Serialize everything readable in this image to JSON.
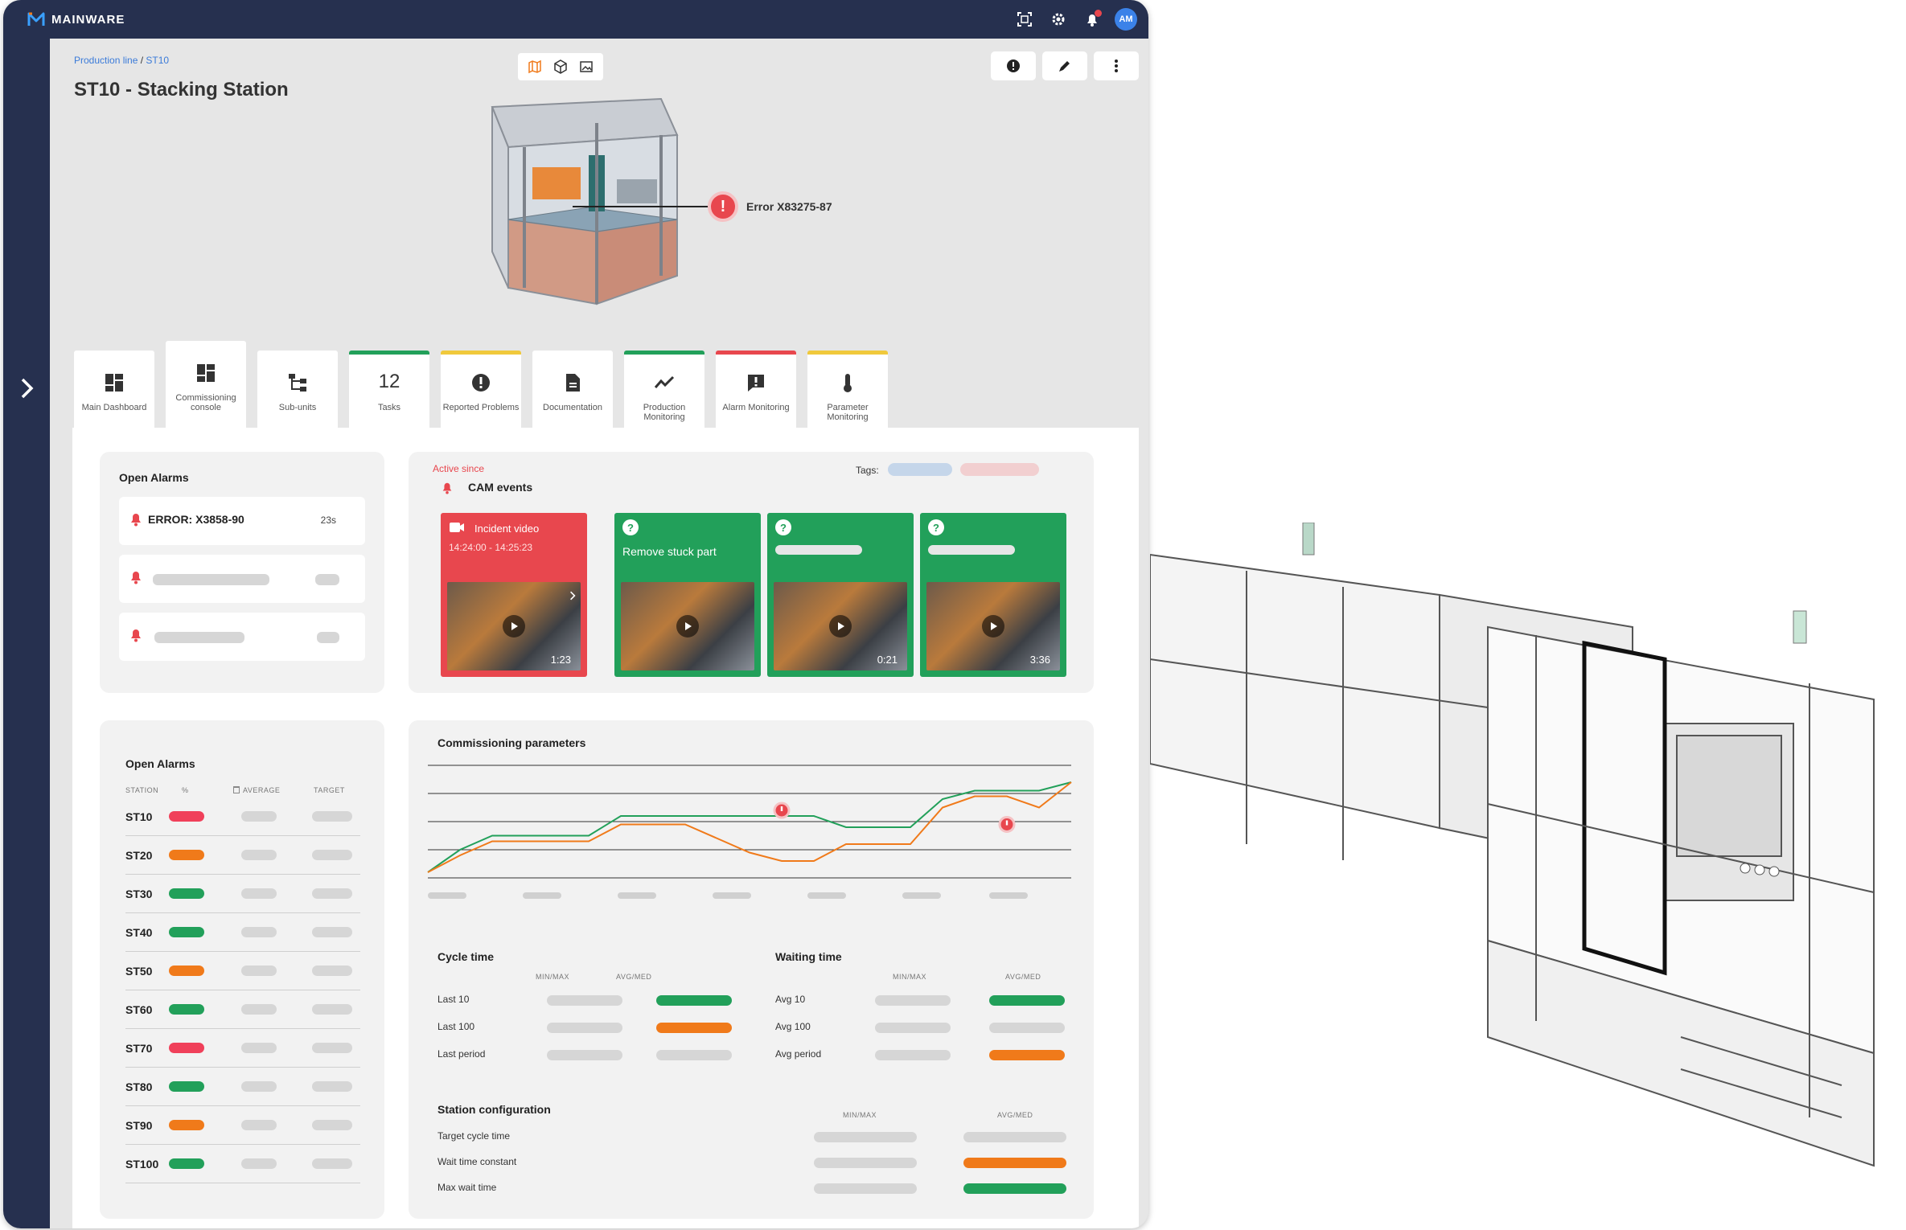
{
  "app": {
    "brand": "MAINWARE",
    "user_initials": "AM"
  },
  "breadcrumb": {
    "root": "Production line",
    "separator": " / ",
    "current": "ST10"
  },
  "page_title": "ST10 - Stacking Station",
  "error_callout": "Error X83275-87",
  "tabs": [
    {
      "label": "Main Dashboard",
      "icon": "dashboard-icon",
      "accent": ""
    },
    {
      "label": "Commissioning console",
      "icon": "dashboard-icon",
      "accent": "",
      "active": true
    },
    {
      "label": "Sub-units",
      "icon": "hierarchy-icon",
      "accent": ""
    },
    {
      "label": "Tasks",
      "value": "12",
      "accent": "#22a05a"
    },
    {
      "label": "Reported Problems",
      "icon": "alert-icon",
      "accent": "#f0c93c"
    },
    {
      "label": "Documentation",
      "icon": "document-icon",
      "accent": ""
    },
    {
      "label": "Production Monitoring",
      "icon": "trend-icon",
      "accent": "#22a05a"
    },
    {
      "label": "Alarm Monitoring",
      "icon": "alarm-message-icon",
      "accent": "#e8474e"
    },
    {
      "label": "Parameter Monitoring",
      "icon": "thermometer-icon",
      "accent": "#f0c93c"
    }
  ],
  "open_alarms": {
    "title": "Open Alarms",
    "first": {
      "text": "ERROR: X3858-90",
      "time": "23s"
    }
  },
  "cam": {
    "active_since": "Active since",
    "title": "CAM events",
    "tags_label": "Tags:",
    "incident": {
      "label": "Incident video",
      "range": "14:24:00 - 14:25:23",
      "duration": "1:23"
    },
    "task1": {
      "label": "Remove stuck part"
    },
    "task2": {
      "duration": "0:21"
    },
    "task3": {
      "duration": "3:36"
    }
  },
  "stations": {
    "title": "Open Alarms",
    "headers": {
      "station": "STATION",
      "pct": "%",
      "average": "AVERAGE",
      "target": "TARGET"
    },
    "rows": [
      {
        "name": "ST10",
        "status": "red"
      },
      {
        "name": "ST20",
        "status": "orange"
      },
      {
        "name": "ST30",
        "status": "green"
      },
      {
        "name": "ST40",
        "status": "green"
      },
      {
        "name": "ST50",
        "status": "orange"
      },
      {
        "name": "ST60",
        "status": "green"
      },
      {
        "name": "ST70",
        "status": "red"
      },
      {
        "name": "ST80",
        "status": "green"
      },
      {
        "name": "ST90",
        "status": "orange"
      },
      {
        "name": "ST100",
        "status": "green"
      }
    ]
  },
  "params": {
    "title": "Commissioning parameters",
    "cycle": {
      "title": "Cycle time",
      "col1": "MIN/MAX",
      "col2": "AVG/MED",
      "rows": [
        "Last 10",
        "Last 100",
        "Last period"
      ]
    },
    "waiting": {
      "title": "Waiting time",
      "col1": "MIN/MAX",
      "col2": "AVG/MED",
      "rows": [
        "Avg 10",
        "Avg 100",
        "Avg period"
      ]
    },
    "config": {
      "title": "Station configuration",
      "col1": "MIN/MAX",
      "col2": "AVG/MED",
      "rows": [
        "Target cycle time",
        "Wait time constant",
        "Max wait time"
      ]
    }
  },
  "colors": {
    "navy": "#26304f",
    "green": "#22a05a",
    "orange": "#f07a1a",
    "red": "#e8474e"
  },
  "chart_data": {
    "type": "line",
    "x": [
      0,
      1,
      2,
      3,
      4,
      5,
      6,
      7,
      8,
      9,
      10,
      11,
      12,
      13,
      14,
      15,
      16,
      17,
      18,
      19,
      20
    ],
    "series": [
      {
        "values": [
          0.2,
          1.0,
          1.5,
          1.5,
          1.5,
          1.5,
          2.2,
          2.2,
          2.2,
          2.2,
          2.2,
          2.2,
          2.2,
          1.8,
          1.8,
          1.8,
          2.8,
          3.1,
          3.1,
          3.1,
          3.4
        ]
      },
      {
        "values": [
          0.2,
          0.8,
          1.3,
          1.3,
          1.3,
          1.3,
          1.9,
          1.9,
          1.9,
          1.4,
          0.9,
          0.6,
          0.6,
          1.2,
          1.2,
          1.2,
          2.5,
          2.9,
          2.9,
          2.5,
          3.4
        ]
      }
    ],
    "ylim": [
      0,
      4
    ]
  }
}
